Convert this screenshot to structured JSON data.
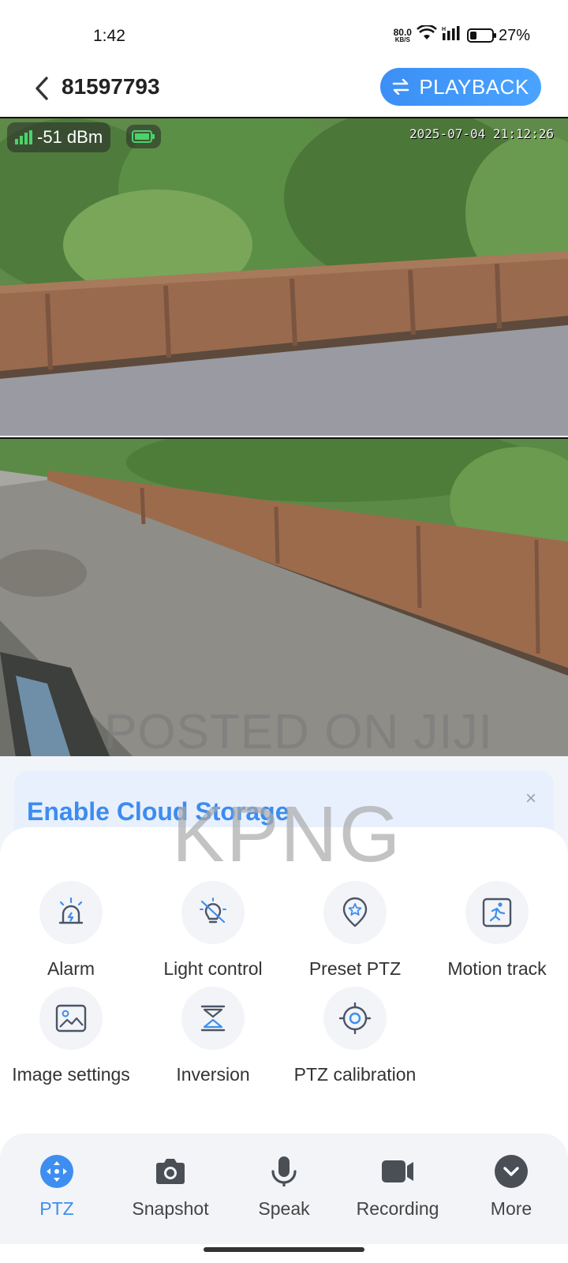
{
  "status_bar": {
    "time": "1:42",
    "net_speed_value": "80.0",
    "net_speed_unit": "KB/S",
    "battery": "27%",
    "battery_level": 0.27
  },
  "header": {
    "device_id": "81597793",
    "playback_label": "PLAYBACK"
  },
  "video": {
    "signal": "-51 dBm",
    "timestamp": "2025-07-04 21:12:26",
    "watermark_line1": "POSTED ON JIJI",
    "watermark_line2": "KPNG"
  },
  "cloud_banner": {
    "title": "Enable Cloud Storage",
    "close": "×"
  },
  "controls": [
    {
      "label": "Alarm",
      "icon": "alarm-icon"
    },
    {
      "label": "Light control",
      "icon": "light-control-icon"
    },
    {
      "label": "Preset PTZ",
      "icon": "preset-ptz-icon"
    },
    {
      "label": "Motion track",
      "icon": "motion-track-icon"
    },
    {
      "label": "Image settings",
      "icon": "image-settings-icon"
    },
    {
      "label": "Inversion",
      "icon": "inversion-icon"
    },
    {
      "label": "PTZ calibration",
      "icon": "ptz-calibration-icon"
    }
  ],
  "toolbar": [
    {
      "label": "PTZ",
      "icon": "ptz-icon",
      "active": true
    },
    {
      "label": "Snapshot",
      "icon": "camera-icon",
      "active": false
    },
    {
      "label": "Speak",
      "icon": "microphone-icon",
      "active": false
    },
    {
      "label": "Recording",
      "icon": "video-record-icon",
      "active": false
    },
    {
      "label": "More",
      "icon": "chevron-down-icon",
      "active": false
    }
  ],
  "colors": {
    "accent": "#3d8ef0",
    "icon_stroke": "#4a5566"
  }
}
